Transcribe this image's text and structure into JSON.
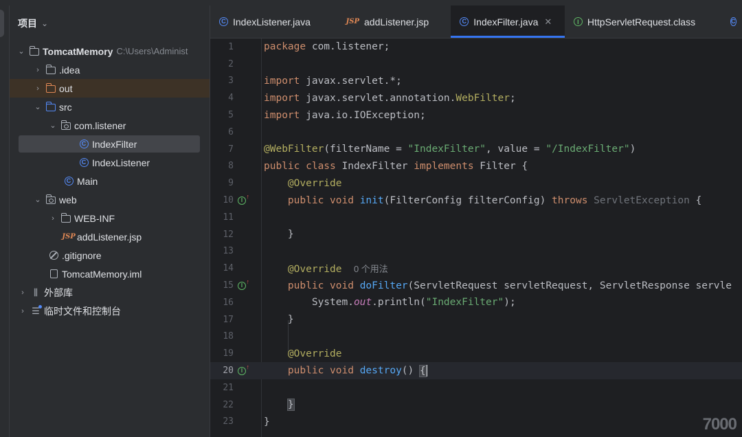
{
  "project_panel": {
    "title": "项目",
    "tree": [
      {
        "label": "TomcatMemory",
        "path": "C:\\Users\\Administ",
        "icon": "module-folder-icon"
      },
      {
        "label": ".idea",
        "icon": "folder-icon"
      },
      {
        "label": "out",
        "icon": "excluded-folder-icon"
      },
      {
        "label": "src",
        "icon": "source-folder-icon"
      },
      {
        "label": "com.listener",
        "icon": "package-icon"
      },
      {
        "label": "IndexFilter",
        "icon": "class-icon"
      },
      {
        "label": "IndexListener",
        "icon": "class-icon"
      },
      {
        "label": "Main",
        "icon": "main-class-icon"
      },
      {
        "label": "web",
        "icon": "web-folder-icon"
      },
      {
        "label": "WEB-INF",
        "icon": "folder-icon"
      },
      {
        "label": "addListener.jsp",
        "icon": "jsp-icon",
        "icon_text": "JSP"
      },
      {
        "label": ".gitignore",
        "icon": "ignore-file-icon"
      },
      {
        "label": "TomcatMemory.iml",
        "icon": "iml-file-icon"
      },
      {
        "label": "外部库",
        "icon": "library-icon"
      },
      {
        "label": "临时文件和控制台",
        "icon": "scratch-icon"
      }
    ]
  },
  "tabs": [
    {
      "label": "IndexListener.java",
      "icon": "class-icon"
    },
    {
      "label": "addListener.jsp",
      "icon": "jsp-icon",
      "icon_text": "JSP"
    },
    {
      "label": "IndexFilter.java",
      "icon": "class-icon",
      "active": true
    },
    {
      "label": "HttpServletRequest.class",
      "icon": "interface-icon"
    }
  ],
  "editor": {
    "line_numbers": [
      "1",
      "2",
      "3",
      "4",
      "5",
      "6",
      "7",
      "8",
      "9",
      "10",
      "11",
      "12",
      "13",
      "14",
      "15",
      "16",
      "17",
      "18",
      "19",
      "20",
      "21",
      "22",
      "23"
    ],
    "current_line": 20,
    "code": {
      "l1_kw": "package",
      "l1_rest": " com.listener;",
      "l3_kw": "import",
      "l3_rest": " javax.servlet.*;",
      "l4_kw": "import",
      "l4_rest": " javax.servlet.annotation.",
      "l4_ann": "WebFilter",
      "l4_end": ";",
      "l5_kw": "import",
      "l5_rest": " java.io.IOException;",
      "l7_ann": "@WebFilter",
      "l7_a": "(filterName = ",
      "l7_s1": "\"IndexFilter\"",
      "l7_b": ", value = ",
      "l7_s2": "\"/IndexFilter\"",
      "l7_c": ")",
      "l8_kw1": "public class",
      "l8_a": " IndexFilter ",
      "l8_kw2": "implements",
      "l8_b": " Filter {",
      "l9_ann": "@Override",
      "l10_kw1": "public void",
      "l10_fn": "init",
      "l10_a": "(FilterConfig filterConfig) ",
      "l10_kw2": "throws",
      "l10_dim": " ServletException",
      "l10_b": " {",
      "l12": "}",
      "l14_ann": "@Override",
      "l14_hint": "0 个用法",
      "l15_kw": "public void",
      "l15_fn": "doFilter",
      "l15_a": "(ServletRequest servletRequest, ServletResponse servle",
      "l16_a": "System.",
      "l16_fld": "out",
      "l16_b": ".println(",
      "l16_s": "\"IndexFilter\"",
      "l16_c": ");",
      "l17": "}",
      "l19_ann": "@Override",
      "l20_kw": "public void",
      "l20_fn": "destroy",
      "l20_a": "() ",
      "l20_brace": "{",
      "l22_brace": "}",
      "l23": "}"
    },
    "gutter_icon": "implements-method-icon"
  },
  "watermark": "7000"
}
